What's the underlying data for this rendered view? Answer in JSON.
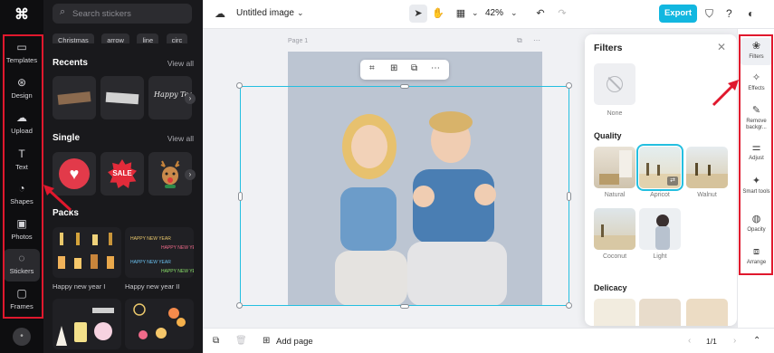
{
  "left_rail": {
    "items": [
      {
        "label": "Templates",
        "icon": "templates-icon"
      },
      {
        "label": "Design",
        "icon": "design-icon"
      },
      {
        "label": "Upload",
        "icon": "upload-icon"
      },
      {
        "label": "Text",
        "icon": "text-icon"
      },
      {
        "label": "Shapes",
        "icon": "shapes-icon"
      },
      {
        "label": "Photos",
        "icon": "photos-icon"
      },
      {
        "label": "Stickers",
        "icon": "stickers-icon",
        "active": true
      },
      {
        "label": "Frames",
        "icon": "frames-icon"
      }
    ]
  },
  "stickers_panel": {
    "search_placeholder": "Search stickers",
    "chips": [
      "Christmas",
      "arrow",
      "line",
      "circ"
    ],
    "recents": {
      "title": "Recents",
      "view_all": "View all",
      "script_text": "Happy Tea"
    },
    "single": {
      "title": "Single",
      "view_all": "View all",
      "sale_text": "SALE"
    },
    "packs": {
      "title": "Packs",
      "items": [
        {
          "label": "Happy new year I"
        },
        {
          "label": "Happy new year II"
        }
      ],
      "new_year_text": "HAPPY NEW YEAR"
    }
  },
  "topbar": {
    "title": "Untitled image",
    "zoom": "42%",
    "export_label": "Export"
  },
  "canvas": {
    "page_label": "Page 1"
  },
  "filters_panel": {
    "title": "Filters",
    "none_label": "None",
    "quality": {
      "title": "Quality",
      "items": [
        "Natural",
        "Apricot",
        "Walnut",
        "Coconut",
        "Light"
      ],
      "selected": "Apricot"
    },
    "delicacy": {
      "title": "Delicacy"
    }
  },
  "right_rail": {
    "items": [
      {
        "label": "Filters",
        "icon": "filters-icon",
        "active": true
      },
      {
        "label": "Effects",
        "icon": "effects-icon"
      },
      {
        "label": "Remove backgr...",
        "icon": "remove-background-icon"
      },
      {
        "label": "Adjust",
        "icon": "adjust-icon"
      },
      {
        "label": "Smart tools",
        "icon": "smart-tools-icon"
      },
      {
        "label": "Opacity",
        "icon": "opacity-icon"
      },
      {
        "label": "Arrange",
        "icon": "arrange-icon"
      }
    ]
  },
  "bottombar": {
    "add_page_label": "Add page",
    "pager": "1/1"
  },
  "colors": {
    "accent": "#12b7e0",
    "annotation_red": "#e0182d",
    "rail_bg": "#0e0e10",
    "panel_bg": "#19191c"
  }
}
